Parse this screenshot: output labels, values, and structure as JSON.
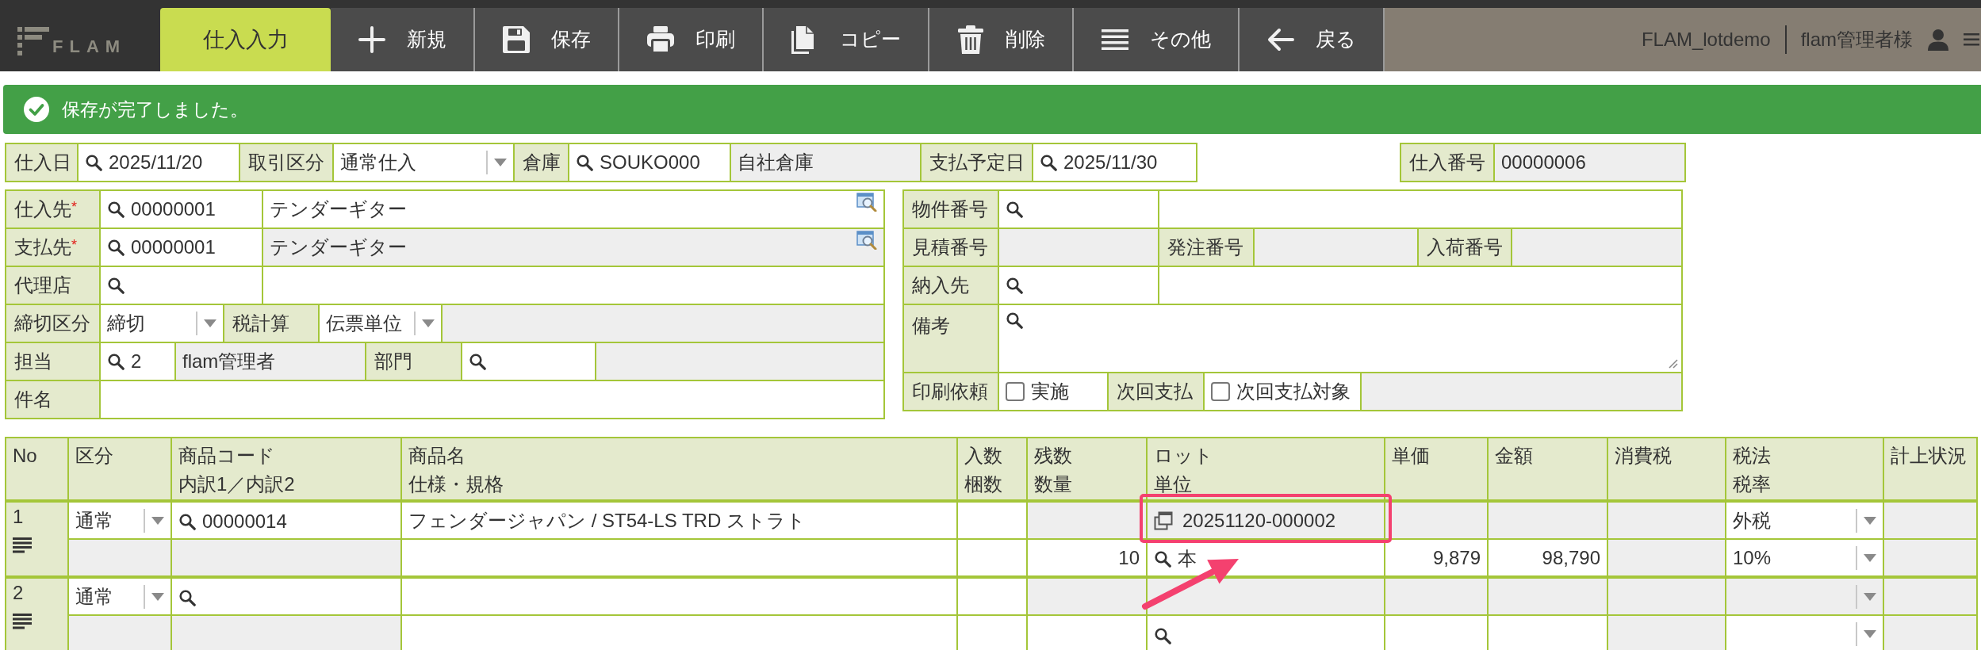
{
  "toolbar": {
    "logo": "FLAM",
    "screen_title": "仕入入力",
    "buttons": [
      {
        "kind": "new",
        "label": "新規"
      },
      {
        "kind": "save",
        "label": "保存"
      },
      {
        "kind": "print",
        "label": "印刷"
      },
      {
        "kind": "copy",
        "label": "コピー"
      },
      {
        "kind": "delete",
        "label": "削除"
      },
      {
        "kind": "more",
        "label": "その他"
      },
      {
        "kind": "back",
        "label": "戻る"
      }
    ],
    "company": "FLAM_lotdemo",
    "user": "flam管理者様"
  },
  "message": {
    "kind": "success",
    "text": "保存が完了しました。"
  },
  "header_row": [
    {
      "kind": "label",
      "text": "仕入日"
    },
    {
      "kind": "lookup",
      "value": "2025/11/20"
    },
    {
      "kind": "label",
      "text": "取引区分"
    },
    {
      "kind": "select",
      "value": "通常仕入"
    },
    {
      "kind": "label",
      "text": "倉庫"
    },
    {
      "kind": "lookup",
      "value": "SOUKO000"
    },
    {
      "kind": "readonly",
      "value": "自社倉庫"
    },
    {
      "kind": "label",
      "text": "支払予定日"
    },
    {
      "kind": "lookup",
      "value": "2025/11/30"
    }
  ],
  "slip_number": [
    {
      "kind": "label",
      "text": "仕入番号"
    },
    {
      "kind": "readonly",
      "value": "00000006"
    }
  ],
  "left_panel": [
    [
      {
        "kind": "label",
        "text": "仕入先",
        "mark": "*"
      },
      {
        "kind": "lookup",
        "value": "00000001"
      },
      {
        "kind": "text",
        "value": "テンダーギター",
        "detail": true
      }
    ],
    [
      {
        "kind": "label",
        "text": "支払先",
        "mark": "*"
      },
      {
        "kind": "lookup",
        "value": "00000001"
      },
      {
        "kind": "readonly",
        "value": "テンダーギター",
        "detail": true
      }
    ],
    [
      {
        "kind": "label",
        "text": "代理店"
      },
      {
        "kind": "lookup"
      },
      {
        "kind": "text"
      }
    ],
    [
      {
        "kind": "label",
        "text": "締切区分"
      },
      {
        "kind": "select",
        "value": "締切"
      },
      {
        "kind": "label",
        "text": "税計算"
      },
      {
        "kind": "select",
        "value": "伝票単位"
      },
      {
        "kind": "readonly"
      }
    ],
    [
      {
        "kind": "label",
        "text": "担当"
      },
      {
        "kind": "lookup",
        "value": "2"
      },
      {
        "kind": "readonly",
        "value": "flam管理者"
      },
      {
        "kind": "label",
        "text": "部門"
      },
      {
        "kind": "lookup"
      },
      {
        "kind": "readonly"
      }
    ],
    [
      {
        "kind": "label",
        "text": "件名"
      },
      {
        "kind": "text"
      }
    ]
  ],
  "right_panel": [
    [
      {
        "kind": "label",
        "text": "物件番号"
      },
      {
        "kind": "lookup"
      },
      {
        "kind": "text"
      }
    ],
    [
      {
        "kind": "label",
        "text": "見積番号"
      },
      {
        "kind": "readonly"
      },
      {
        "kind": "label",
        "text": "発注番号"
      },
      {
        "kind": "readonly"
      },
      {
        "kind": "label",
        "text": "入荷番号"
      },
      {
        "kind": "readonly"
      }
    ],
    [
      {
        "kind": "label",
        "text": "納入先"
      },
      {
        "kind": "lookup"
      },
      {
        "kind": "text"
      }
    ],
    [
      {
        "kind": "label",
        "text": "備考"
      },
      {
        "kind": "memo"
      }
    ],
    [
      {
        "kind": "label",
        "text": "印刷依頼"
      },
      {
        "kind": "checkbox",
        "label": "実施",
        "checked": false
      },
      {
        "kind": "label",
        "text": "次回支払"
      },
      {
        "kind": "checkbox",
        "label": "次回支払対象",
        "checked": false
      },
      {
        "kind": "readonly"
      }
    ]
  ],
  "table": {
    "columns": [
      {
        "label": "No"
      },
      {
        "label": "区分"
      },
      {
        "label": "商品コード",
        "sublabel": "内訳1／内訳2"
      },
      {
        "label": "商品名",
        "sublabel": "仕様・規格"
      },
      {
        "label": "入数",
        "sublabel": "梱数"
      },
      {
        "label": "残数",
        "sublabel": "数量"
      },
      {
        "label": "ロット",
        "sublabel": "単位"
      },
      {
        "label": "単価"
      },
      {
        "label": "金額"
      },
      {
        "label": "消費税"
      },
      {
        "label": "税法",
        "sublabel": "税率"
      },
      {
        "label": "計上状況"
      }
    ],
    "rows": [
      {
        "no": "1",
        "lines": [
          [
            {
              "kind": "select",
              "value": "通常",
              "disabled": false
            },
            {
              "kind": "lookup",
              "value": "00000014"
            },
            {
              "kind": "input",
              "value": "フェンダージャパン / ST54-LS TRD ストラト"
            },
            {
              "kind": "input"
            },
            {
              "kind": "readonly"
            },
            {
              "kind": "lot",
              "value": "20251120-000002",
              "highlighted": true
            },
            {
              "kind": "readonly"
            },
            {
              "kind": "readonly"
            },
            {
              "kind": "readonly"
            },
            {
              "kind": "select",
              "value": "外税",
              "disabled": false
            },
            {
              "kind": "readonly"
            }
          ],
          [
            {
              "kind": "readonly"
            },
            {
              "kind": "readonly"
            },
            {
              "kind": "input"
            },
            {
              "kind": "input"
            },
            {
              "kind": "number",
              "value": "10"
            },
            {
              "kind": "lookup",
              "value": "本"
            },
            {
              "kind": "number",
              "value": "9,879"
            },
            {
              "kind": "number",
              "value": "98,790"
            },
            {
              "kind": "readonly"
            },
            {
              "kind": "select",
              "value": "10%",
              "disabled": false
            },
            {
              "kind": "readonly"
            }
          ]
        ]
      },
      {
        "no": "2",
        "lines": [
          [
            {
              "kind": "select",
              "value": "通常",
              "disabled": false
            },
            {
              "kind": "lookup"
            },
            {
              "kind": "input"
            },
            {
              "kind": "input"
            },
            {
              "kind": "readonly"
            },
            {
              "kind": "readonly"
            },
            {
              "kind": "readonly"
            },
            {
              "kind": "readonly"
            },
            {
              "kind": "readonly"
            },
            {
              "kind": "select",
              "disabled": true
            },
            {
              "kind": "readonly"
            }
          ],
          [
            {
              "kind": "readonly"
            },
            {
              "kind": "readonly"
            },
            {
              "kind": "input"
            },
            {
              "kind": "input"
            },
            {
              "kind": "number"
            },
            {
              "kind": "lookup"
            },
            {
              "kind": "number"
            },
            {
              "kind": "number"
            },
            {
              "kind": "readonly"
            },
            {
              "kind": "select",
              "disabled": false
            },
            {
              "kind": "readonly"
            }
          ]
        ]
      }
    ]
  },
  "annotations": [
    {
      "kind": "arrow"
    }
  ]
}
